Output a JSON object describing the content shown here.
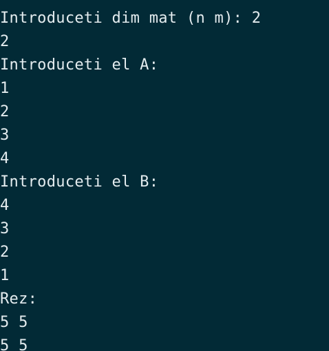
{
  "terminal": {
    "background": "#022a36",
    "foreground": "#e4ecef",
    "lines": [
      "Introduceti dim mat (n m): 2",
      "2",
      "Introduceti el A:",
      "1",
      "2",
      "3",
      "4",
      "Introduceti el B:",
      "4",
      "3",
      "2",
      "1",
      "Rez:",
      "5 5",
      "5 5"
    ]
  }
}
